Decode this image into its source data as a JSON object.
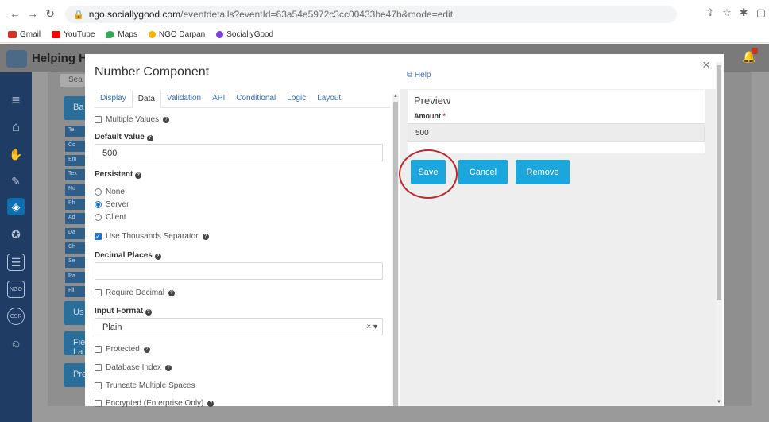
{
  "browser": {
    "url_host": "ngo.sociallygood.com",
    "url_path": "/eventdetails?eventId=63a54e5972c3cc00433be47b&mode=edit",
    "bookmarks": [
      {
        "label": "Gmail",
        "color": "#d93025"
      },
      {
        "label": "YouTube",
        "color": "#ff0000"
      },
      {
        "label": "Maps",
        "color": "#34a853"
      },
      {
        "label": "NGO Darpan",
        "color": "#f4b400"
      },
      {
        "label": "SociallyGood",
        "color": "#7b3fe4"
      }
    ]
  },
  "app": {
    "title": "Helping Ha",
    "search_placeholder": "Sea",
    "side_buttons": [
      "Ba",
      "Us",
      "Fie La",
      "Pre"
    ],
    "component_items": [
      "Te",
      "Co",
      "Em",
      "Tex",
      "Nu",
      "Ph",
      "Ad",
      "Da",
      "Ch",
      "Se",
      "Ra",
      "Fil"
    ]
  },
  "modal": {
    "title": "Number Component",
    "help": "Help",
    "close": "×",
    "tabs": [
      "Display",
      "Data",
      "Validation",
      "API",
      "Conditional",
      "Logic",
      "Layout"
    ],
    "active_tab": "Data",
    "multiple_values": "Multiple Values",
    "default_value_label": "Default Value",
    "default_value": "500",
    "persistent_label": "Persistent",
    "persistent_options": [
      "None",
      "Server",
      "Client"
    ],
    "persistent_selected": "Server",
    "thousands_separator": "Use Thousands Separator",
    "decimal_places_label": "Decimal Places",
    "decimal_places_value": "",
    "require_decimal": "Require Decimal",
    "input_format_label": "Input Format",
    "input_format_value": "Plain",
    "protected": "Protected",
    "database_index": "Database Index",
    "truncate_spaces": "Truncate Multiple Spaces",
    "encrypted": "Encrypted (Enterprise Only)"
  },
  "preview": {
    "title": "Preview",
    "field_label": "Amount",
    "required_mark": "*",
    "field_value": "500",
    "save": "Save",
    "cancel": "Cancel",
    "remove": "Remove"
  },
  "colors": {
    "accent": "#1ba6dd",
    "link": "#3b6fb6",
    "annotation_ring": "#c0282d",
    "sidebar": "#1e3c64"
  }
}
